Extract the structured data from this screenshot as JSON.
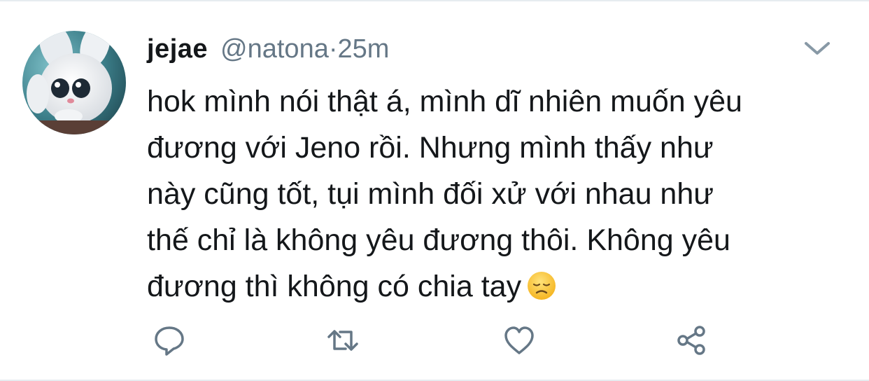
{
  "tweet": {
    "display_name": "jejae",
    "handle": "@natona",
    "separator": "·",
    "time": "25m",
    "lines": [
      "hok mình nói thật á, mình dĩ nhiên muốn yêu",
      "đương với Jeno rồi. Nhưng mình thấy như",
      "này cũng tốt, tụi mình đối xử với nhau như",
      "thế chỉ là không yêu đương thôi. Không yêu",
      "đương thì không có chia tay"
    ],
    "emoji": "disappointed-face"
  },
  "icons": {
    "avatar": "white-bunny-avatar",
    "menu": "chevron-down-icon",
    "reply": "reply-icon",
    "retweet": "retweet-icon",
    "like": "heart-icon",
    "share": "share-icon"
  },
  "colors": {
    "text": "#14171a",
    "secondary": "#657786",
    "icon": "#657786",
    "border": "#e6ecf0"
  }
}
